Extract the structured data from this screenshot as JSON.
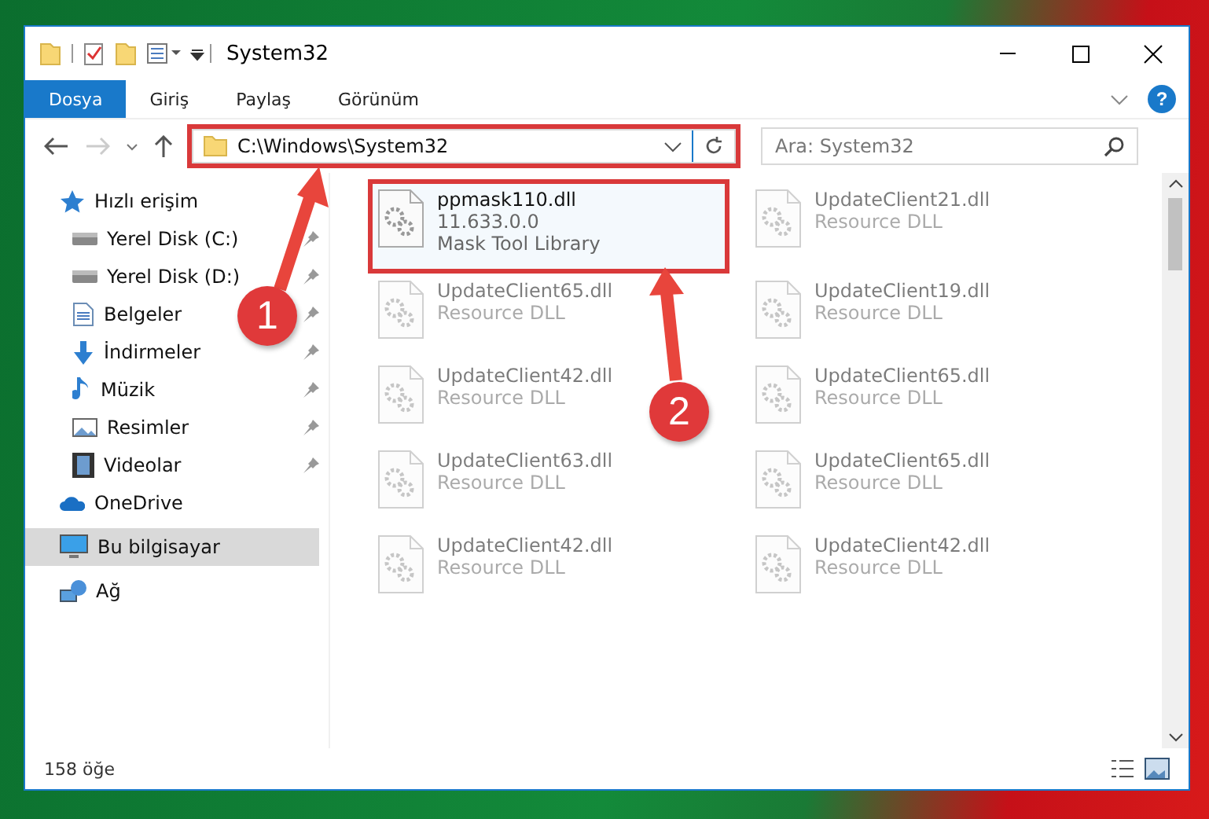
{
  "window": {
    "title": "System32"
  },
  "ribbon_tabs": [
    {
      "label": "Dosya",
      "selected": true
    },
    {
      "label": "Giriş",
      "selected": false
    },
    {
      "label": "Paylaş",
      "selected": false
    },
    {
      "label": "Görünüm",
      "selected": false
    }
  ],
  "help_button": {
    "label": "?"
  },
  "address_bar": {
    "path": "C:\\Windows\\System32",
    "highlighted": true
  },
  "search": {
    "placeholder": "Ara: System32"
  },
  "sidebar": {
    "items": [
      {
        "label": "Hızlı erişim",
        "kind": "star",
        "pinned": false,
        "selected": false,
        "children": [
          {
            "label": "Yerel Disk (C:)",
            "kind": "drive",
            "pinned": true,
            "selected": false
          },
          {
            "label": "Yerel Disk (D:)",
            "kind": "drive",
            "pinned": true,
            "selected": false
          },
          {
            "label": "Belgeler",
            "kind": "document",
            "pinned": true,
            "selected": false
          },
          {
            "label": "İndirmeler",
            "kind": "download",
            "pinned": true,
            "selected": false
          },
          {
            "label": "Müzik",
            "kind": "music",
            "pinned": true,
            "selected": false
          },
          {
            "label": "Resimler",
            "kind": "picture",
            "pinned": true,
            "selected": false
          },
          {
            "label": "Videolar",
            "kind": "video",
            "pinned": true,
            "selected": false
          }
        ]
      },
      {
        "label": "OneDrive",
        "kind": "cloud",
        "pinned": false,
        "selected": false
      },
      {
        "label": "Bu bilgisayar",
        "kind": "computer",
        "pinned": false,
        "selected": true
      },
      {
        "label": "Ağ",
        "kind": "network",
        "pinned": false,
        "selected": false
      }
    ]
  },
  "files": [
    {
      "name": "ppmask110.dll",
      "version": "11.633.0.0",
      "description": "Mask Tool Library",
      "highlighted": true,
      "dimmed": false
    },
    {
      "name": "UpdateClient21.dll",
      "description": "Resource DLL",
      "highlighted": false,
      "dimmed": true
    },
    {
      "name": "UpdateClient65.dll",
      "description": "Resource DLL",
      "highlighted": false,
      "dimmed": true
    },
    {
      "name": "UpdateClient19.dll",
      "description": "Resource DLL",
      "highlighted": false,
      "dimmed": true
    },
    {
      "name": "UpdateClient42.dll",
      "description": "Resource DLL",
      "highlighted": false,
      "dimmed": true
    },
    {
      "name": "UpdateClient65.dll",
      "description": "Resource DLL",
      "highlighted": false,
      "dimmed": true
    },
    {
      "name": "UpdateClient63.dll",
      "description": "Resource DLL",
      "highlighted": false,
      "dimmed": true
    },
    {
      "name": "UpdateClient65.dll",
      "description": "Resource DLL",
      "highlighted": false,
      "dimmed": true
    },
    {
      "name": "UpdateClient42.dll",
      "description": "Resource DLL",
      "highlighted": false,
      "dimmed": true
    },
    {
      "name": "UpdateClient42.dll",
      "description": "Resource DLL",
      "highlighted": false,
      "dimmed": true
    }
  ],
  "status_bar": {
    "item_count": "158 öğe"
  },
  "callouts": [
    {
      "number": "1"
    },
    {
      "number": "2"
    }
  ]
}
